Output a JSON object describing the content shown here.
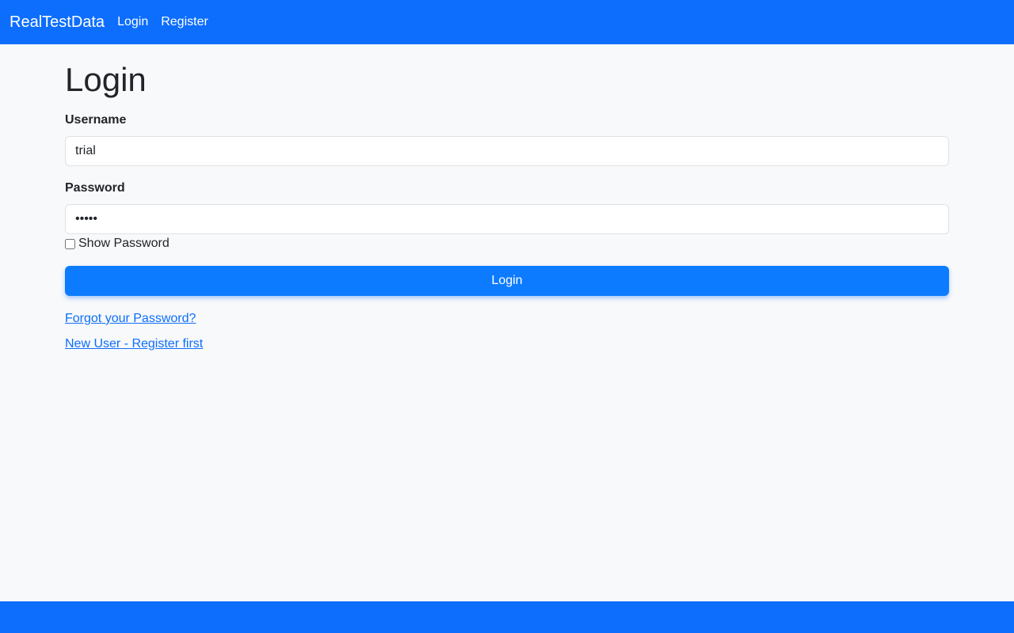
{
  "navbar": {
    "brand": "RealTestData",
    "links": [
      "Login",
      "Register"
    ],
    "color": "#0d6efd"
  },
  "page": {
    "title": "Login"
  },
  "form": {
    "username_label": "Username",
    "username_value": "trial",
    "password_label": "Password",
    "password_value": "•••••",
    "show_password_label": "Show Password",
    "show_password_checked": false,
    "submit_label": "Login"
  },
  "links": {
    "forgot_password": "Forgot your Password?",
    "register": "New User - Register first"
  }
}
